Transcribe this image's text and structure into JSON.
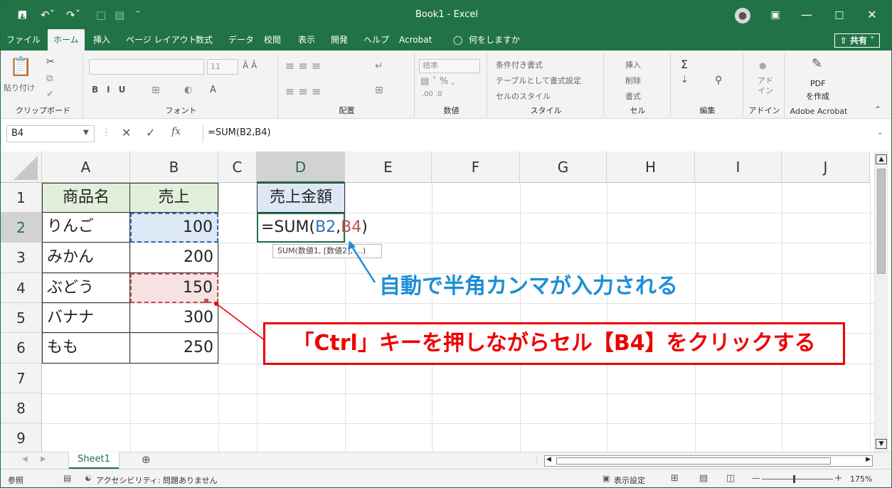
{
  "titlebar": {
    "title": "Book1  -  Excel",
    "save_icon": "save-icon",
    "undo_icon": "undo-icon",
    "redo_icon": "redo-icon"
  },
  "tabs": [
    {
      "label": "ファイル"
    },
    {
      "label": "ホーム"
    },
    {
      "label": "挿入"
    },
    {
      "label": "ページ レイアウト"
    },
    {
      "label": "数式"
    },
    {
      "label": "データ"
    },
    {
      "label": "校閲"
    },
    {
      "label": "表示"
    },
    {
      "label": "開発"
    },
    {
      "label": "ヘルプ"
    },
    {
      "label": "Acrobat"
    },
    {
      "label": "何をしますか"
    }
  ],
  "share_label": "共有",
  "ribbon": {
    "clipboard": {
      "label": "クリップボード",
      "paste": "貼り付け"
    },
    "font": {
      "label": "フォント",
      "size": "11"
    },
    "alignment": {
      "label": "配置"
    },
    "number": {
      "label": "数値",
      "format": "標準"
    },
    "styles": {
      "label": "スタイル",
      "cond": "条件付き書式",
      "table": "テーブルとして書式設定",
      "cell": "セルのスタイル"
    },
    "cells": {
      "label": "セル",
      "insert": "挿入",
      "delete": "削除",
      "format": "書式"
    },
    "editing": {
      "label": "編集"
    },
    "addins": {
      "label": "アドイン",
      "btn": "アド\nイン"
    },
    "acrobat": {
      "label": "Adobe Acrobat",
      "pdf1": "PDF",
      "pdf2": "を作成"
    }
  },
  "formula_bar": {
    "name_box": "B4",
    "formula": "=SUM(B2,B4)"
  },
  "columns": [
    "A",
    "B",
    "C",
    "D",
    "E",
    "F",
    "G",
    "H",
    "I",
    "J"
  ],
  "rows": [
    "1",
    "2",
    "3",
    "4",
    "5",
    "6",
    "7",
    "8",
    "9"
  ],
  "table": {
    "headers": [
      "商品名",
      "売上"
    ],
    "items": [
      {
        "name": "りんご",
        "sales": "100"
      },
      {
        "name": "みかん",
        "sales": "200"
      },
      {
        "name": "ぶどう",
        "sales": "150"
      },
      {
        "name": "バナナ",
        "sales": "300"
      },
      {
        "name": "もも",
        "sales": "250"
      }
    ]
  },
  "d_header": "売上金額",
  "editing_formula": {
    "prefix": "=SUM(",
    "ref1": "B2",
    "comma": ",",
    "ref2": "B4",
    "suffix": ")"
  },
  "tooltip": "SUM(数値1, [数値2], ...)",
  "annotations": {
    "blue": "自動で半角カンマが入力される",
    "red": "「Ctrl」キーを押しながらセル【B4】をクリックする"
  },
  "sheet_tab": "Sheet1",
  "status": {
    "mode": "参照",
    "accessibility": "アクセシビリティ: 問題ありません",
    "display_settings": "表示設定",
    "zoom": "175%"
  },
  "colors": {
    "excel_green": "#217346",
    "ref_blue": "#2f6fb5",
    "ref_red": "#c0504d",
    "annotation_blue": "#1e8fd6",
    "annotation_red": "#ee0000"
  }
}
